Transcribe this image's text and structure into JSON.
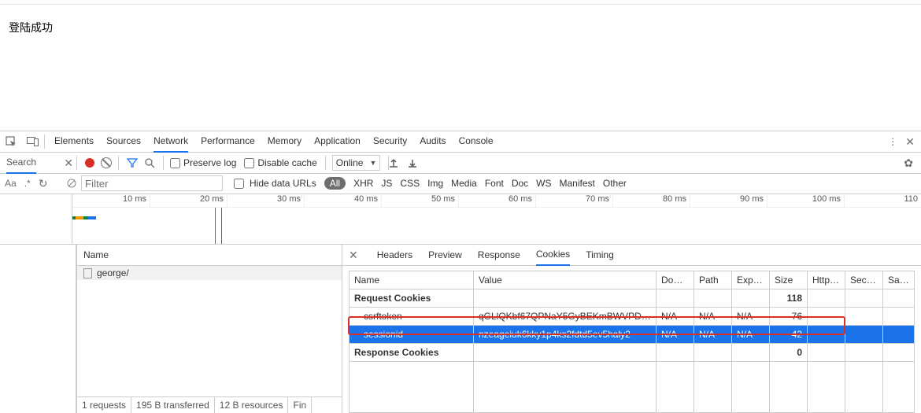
{
  "page": {
    "login_text": "登陆成功"
  },
  "tabs": {
    "elements": "Elements",
    "sources": "Sources",
    "network": "Network",
    "performance": "Performance",
    "memory": "Memory",
    "application": "Application",
    "security": "Security",
    "audits": "Audits",
    "console": "Console"
  },
  "search_panel": {
    "label": "Search",
    "aa": "Aa",
    "regex": ".*"
  },
  "toolbar": {
    "preserve_log": "Preserve log",
    "disable_cache": "Disable cache",
    "throttle": "Online"
  },
  "filterbar": {
    "placeholder": "Filter",
    "hide_data_urls": "Hide data URLs",
    "cats": {
      "all": "All",
      "xhr": "XHR",
      "js": "JS",
      "css": "CSS",
      "img": "Img",
      "media": "Media",
      "font": "Font",
      "doc": "Doc",
      "ws": "WS",
      "manifest": "Manifest",
      "other": "Other"
    }
  },
  "timeline": {
    "ticks": [
      "10 ms",
      "20 ms",
      "30 ms",
      "40 ms",
      "50 ms",
      "60 ms",
      "70 ms",
      "80 ms",
      "90 ms",
      "100 ms",
      "110"
    ]
  },
  "requests": {
    "name_hdr": "Name",
    "items": [
      {
        "name": "george/"
      }
    ],
    "summary": {
      "count": "1 requests",
      "transferred": "195 B transferred",
      "resources": "12 B resources",
      "finish": "Fin"
    }
  },
  "detail_tabs": {
    "headers": "Headers",
    "preview": "Preview",
    "response": "Response",
    "cookies": "Cookies",
    "timing": "Timing"
  },
  "cookies": {
    "cols": {
      "name": "Name",
      "value": "Value",
      "domain": "Dom…",
      "path": "Path",
      "expires": "Expi…",
      "size": "Size",
      "http": "Http…",
      "secure": "Secure",
      "same": "Sam…"
    },
    "section_request": "Request Cookies",
    "section_response": "Response Cookies",
    "rows": [
      {
        "name": "csrftoken",
        "value": "qGLlQKbf67QPNaY5GyBEKmBWVPD…",
        "domain": "N/A",
        "path": "N/A",
        "expires": "N/A",
        "size": "76",
        "http": "",
        "secure": "",
        "same": ""
      },
      {
        "name": "sessionid",
        "value": "nzeageiuk6kky1p4ks2fdtd5ev5haly2",
        "domain": "N/A",
        "path": "N/A",
        "expires": "N/A",
        "size": "42",
        "http": "",
        "secure": "",
        "same": ""
      }
    ],
    "req_total_size": "118",
    "resp_total_size": "0"
  }
}
